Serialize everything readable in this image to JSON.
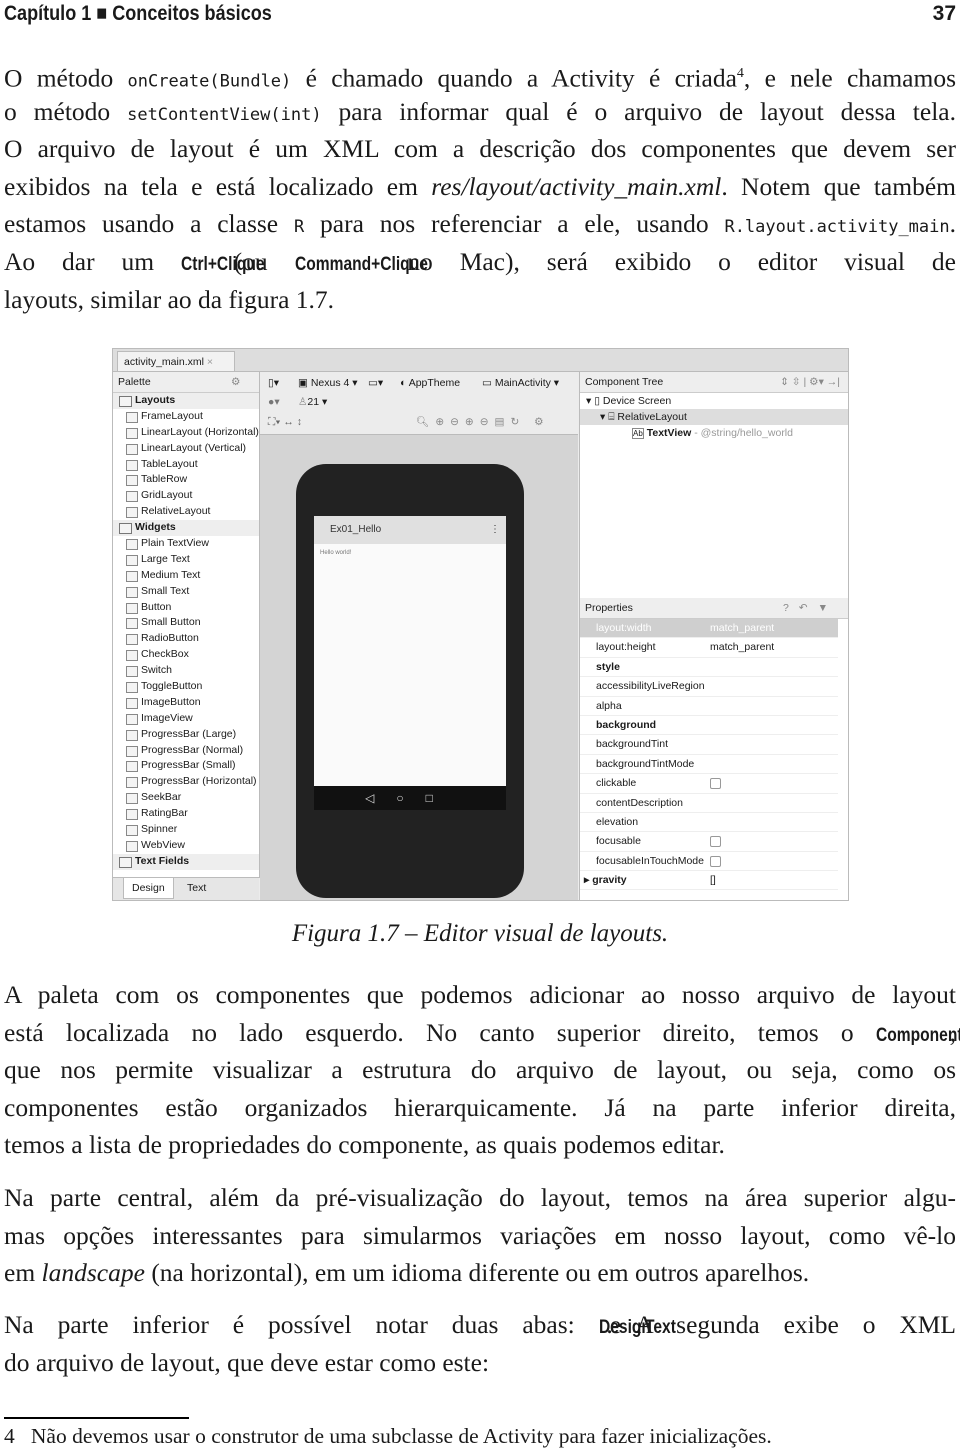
{
  "header": {
    "chapter": "Capítulo 1 ■ Conceitos básicos",
    "page": "37"
  },
  "para1": [
    [
      {
        "t": "O método "
      },
      {
        "t": "onCreate(Bundle)",
        "s": "code"
      },
      {
        "t": " é chamado quando a Activity é criada"
      },
      {
        "t": "4",
        "s": "sup"
      },
      {
        "t": ", e nele chamamos"
      }
    ],
    [
      {
        "t": "o método "
      },
      {
        "t": "setContentView(int)",
        "s": "code"
      },
      {
        "t": " para informar qual é o arquivo de layout dessa tela."
      }
    ],
    [
      {
        "t": "O arquivo de layout é um XML com a descrição dos componentes que devem ser"
      }
    ],
    [
      {
        "t": "exibidos na tela e está localizado em "
      },
      {
        "t": "res/layout/activity_main.xml",
        "s": "it"
      },
      {
        "t": ". Notem que também"
      }
    ],
    [
      {
        "t": "estamos usando a classe "
      },
      {
        "t": "R",
        "s": "code"
      },
      {
        "t": " para nos referenciar a ele, usando "
      },
      {
        "t": "R.layout.activity_main",
        "s": "code"
      },
      {
        "t": "."
      }
    ],
    [
      {
        "t": "Ao dar um "
      },
      {
        "t": "Ctrl+Clique",
        "s": "cond"
      },
      {
        "t": " (ou "
      },
      {
        "t": "Command+Clique",
        "s": "cond"
      },
      {
        "t": " no Mac), será exibido o editor visual de"
      }
    ],
    [
      {
        "t": "layouts, similar ao da figura 1.7."
      }
    ]
  ],
  "figure": {
    "file_tab": "activity_main.xml",
    "palette": {
      "title": "Palette",
      "items": [
        {
          "label": "Layouts",
          "cat": true
        },
        {
          "label": "FrameLayout"
        },
        {
          "label": "LinearLayout (Horizontal)"
        },
        {
          "label": "LinearLayout (Vertical)"
        },
        {
          "label": "TableLayout"
        },
        {
          "label": "TableRow"
        },
        {
          "label": "GridLayout"
        },
        {
          "label": "RelativeLayout"
        },
        {
          "label": "Widgets",
          "cat": true
        },
        {
          "label": "Plain TextView"
        },
        {
          "label": "Large Text"
        },
        {
          "label": "Medium Text"
        },
        {
          "label": "Small Text"
        },
        {
          "label": "Button"
        },
        {
          "label": "Small Button"
        },
        {
          "label": "RadioButton"
        },
        {
          "label": "CheckBox"
        },
        {
          "label": "Switch"
        },
        {
          "label": "ToggleButton"
        },
        {
          "label": "ImageButton"
        },
        {
          "label": "ImageView"
        },
        {
          "label": "ProgressBar (Large)"
        },
        {
          "label": "ProgressBar (Normal)"
        },
        {
          "label": "ProgressBar (Small)"
        },
        {
          "label": "ProgressBar (Horizontal)"
        },
        {
          "label": "SeekBar"
        },
        {
          "label": "RatingBar"
        },
        {
          "label": "Spinner"
        },
        {
          "label": "WebView"
        },
        {
          "label": "Text Fields",
          "cat": true
        }
      ]
    },
    "bottom_tabs": [
      "Design",
      "Text"
    ],
    "toolbar": {
      "device": "Nexus 4 ▾",
      "theme": "AppTheme",
      "activity": "MainActivity ▾",
      "api": "21 ▾"
    },
    "phone": {
      "app_title": "Ex01_Hello",
      "text": "Hello world!",
      "nav": "◁○□"
    },
    "component_tree": {
      "title": "Component Tree",
      "nodes": [
        "Device Screen",
        "RelativeLayout",
        "TextView"
      ],
      "textview_value": "- @string/hello_world"
    },
    "properties": {
      "title": "Properties",
      "rows": [
        {
          "k": "layout:width",
          "v": "match_parent",
          "sel": true
        },
        {
          "k": "layout:height",
          "v": "match_parent"
        },
        {
          "k": "style",
          "b": true
        },
        {
          "k": "accessibilityLiveRegion"
        },
        {
          "k": "alpha"
        },
        {
          "k": "background",
          "b": true
        },
        {
          "k": "backgroundTint"
        },
        {
          "k": "backgroundTintMode"
        },
        {
          "k": "clickable",
          "cb": true
        },
        {
          "k": "contentDescription"
        },
        {
          "k": "elevation"
        },
        {
          "k": "focusable",
          "cb": true
        },
        {
          "k": "focusableInTouchMode",
          "cb": true
        },
        {
          "k": "gravity",
          "v": "[]",
          "b": true,
          "exp": true
        }
      ]
    }
  },
  "caption": "Figura 1.7 – Editor visual de layouts.",
  "para2": [
    [
      {
        "t": "A paleta com os componentes que podemos adicionar ao nosso arquivo de layout"
      }
    ],
    [
      {
        "t": "está localizada no lado esquerdo. No canto superior direito, temos o "
      },
      {
        "t": "Component Tree",
        "s": "cond"
      },
      {
        "t": ","
      }
    ],
    [
      {
        "t": "que nos permite visualizar a estrutura do arquivo de layout, ou seja, como os"
      }
    ],
    [
      {
        "t": "componentes estão organizados hierarquicamente. Já na parte inferior direita,"
      }
    ],
    [
      {
        "t": "temos a lista de propriedades do componente, as quais podemos editar."
      }
    ]
  ],
  "para3": [
    [
      {
        "t": "Na parte central, além da pré-visualização do layout, temos na área superior algu-"
      }
    ],
    [
      {
        "t": "mas opções interessantes para simularmos variações em nosso layout, como vê-lo"
      }
    ],
    [
      {
        "t": "em "
      },
      {
        "t": "landscape",
        "s": "it"
      },
      {
        "t": " (na horizontal), em um idioma diferente ou em outros aparelhos."
      }
    ]
  ],
  "para4": [
    [
      {
        "t": "Na parte inferior é possível notar duas abas: "
      },
      {
        "t": "Design",
        "s": "cond"
      },
      {
        "t": " e "
      },
      {
        "t": "Text",
        "s": "cond"
      },
      {
        "t": ". A segunda exibe o XML"
      }
    ],
    [
      {
        "t": "do arquivo de layout, que deve estar como este:"
      }
    ]
  ],
  "footnote": {
    "num": "4",
    "text": "Não devemos usar o construtor de uma subclasse de Activity para fazer inicializações."
  }
}
